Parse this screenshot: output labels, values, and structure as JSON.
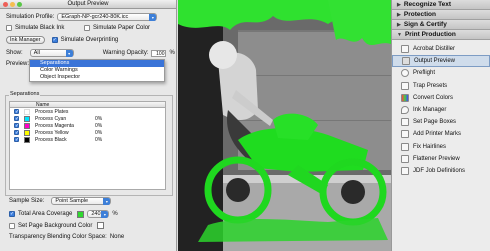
{
  "dialog": {
    "title": "Output Preview",
    "simulation_profile_label": "Simulation Profile:",
    "simulation_profile_value": "EGraph-NP-gcr240-80K.icc",
    "simulate_black_ink": "Simulate Black Ink",
    "simulate_paper_color": "Simulate Paper Color",
    "ink_manager": "Ink Manager",
    "simulate_overprinting": "Simulate Overprinting",
    "show_label": "Show:",
    "show_value": "All",
    "warning_opacity_label": "Warning Opacity:",
    "warning_opacity_value": "100",
    "percent": "%",
    "preview_label": "Preview:",
    "preview_options": [
      "Separations",
      "Color Warnings",
      "Object Inspector"
    ],
    "separations_label": "Separations",
    "col_name": "Name",
    "plates": [
      {
        "name": "Process Plates",
        "value": "",
        "color": "#ffffff"
      },
      {
        "name": "Process Cyan",
        "value": "0%",
        "color": "#00e5ff"
      },
      {
        "name": "Process Magenta",
        "value": "0%",
        "color": "#ff00c8"
      },
      {
        "name": "Process Yellow",
        "value": "0%",
        "color": "#ffff00"
      },
      {
        "name": "Process Black",
        "value": "0%",
        "color": "#000000"
      }
    ],
    "sample_size_label": "Sample Size:",
    "sample_size_value": "Point Sample",
    "total_area_coverage": "Total Area Coverage",
    "tac_value": "240",
    "set_page_bg": "Set Page Background Color",
    "transparency_label": "Transparency Blending Color Space:",
    "transparency_value": "None"
  },
  "panel": {
    "sections": [
      "Recognize Text",
      "Protection",
      "Sign & Certify",
      "Print Production"
    ],
    "items": [
      "Acrobat Distiller",
      "Output Preview",
      "Preflight",
      "Trap Presets",
      "Convert Colors",
      "Ink Manager",
      "Set Page Boxes",
      "Add Printer Marks",
      "Fix Hairlines",
      "Flattener Preview",
      "JDF Job Definitions"
    ]
  }
}
